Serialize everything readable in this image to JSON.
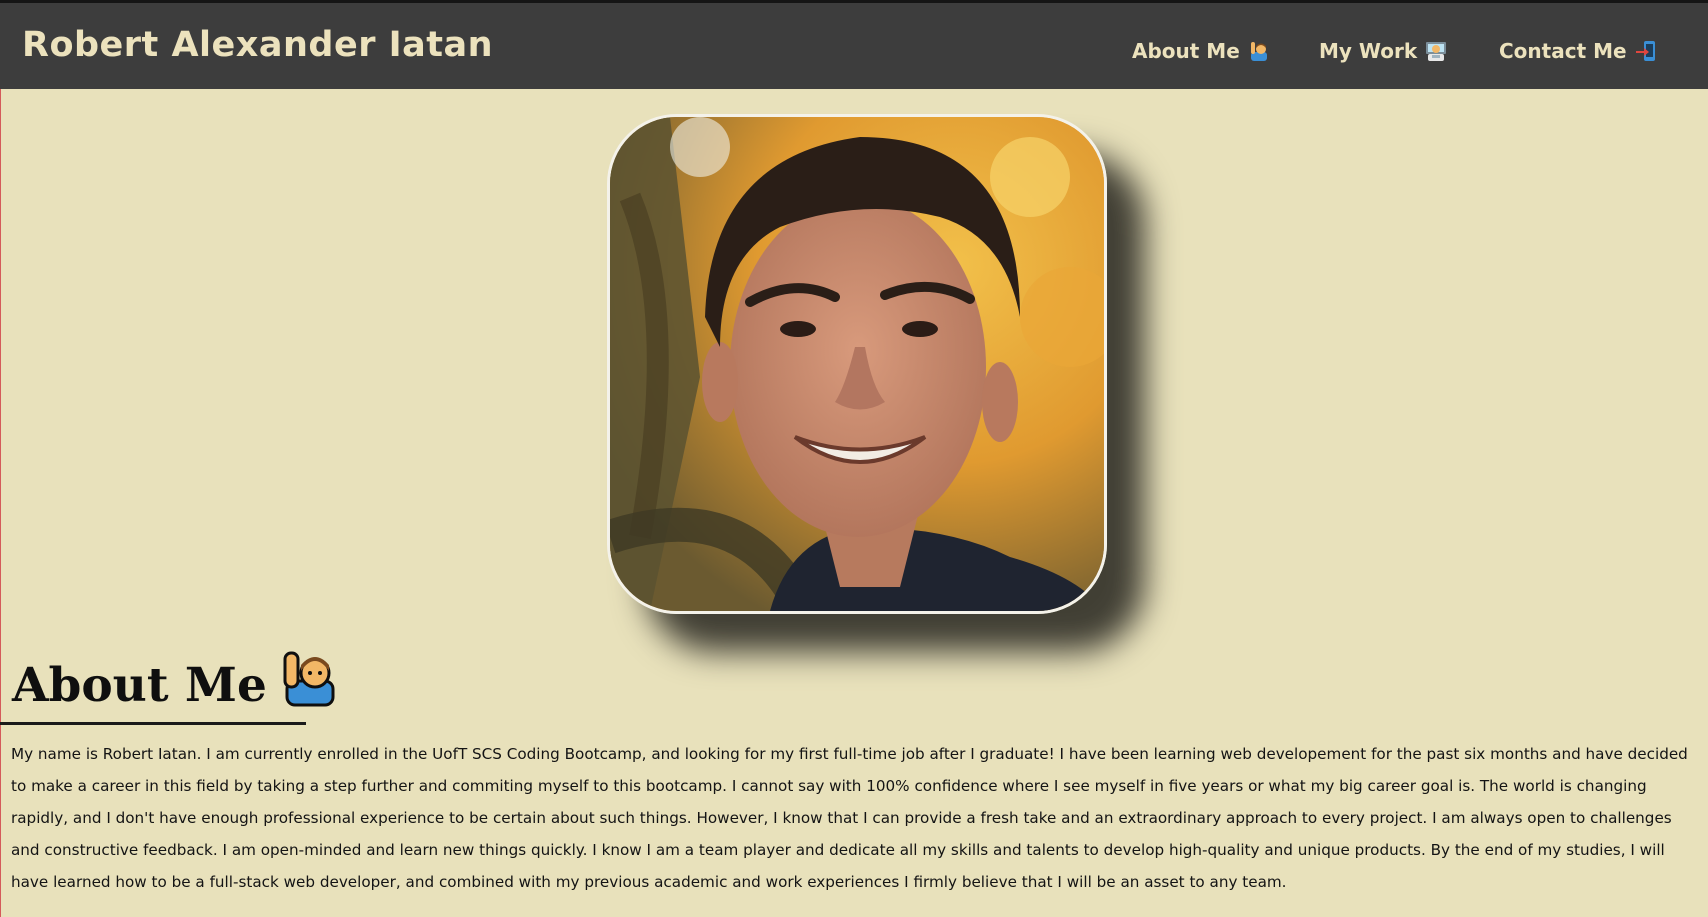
{
  "header": {
    "brand": "Robert Alexander Iatan",
    "nav": [
      {
        "label": "About Me",
        "icon": "person-raising-hand-icon"
      },
      {
        "label": "My Work",
        "icon": "technologist-icon"
      },
      {
        "label": "Contact Me",
        "icon": "mobile-phone-arrow-icon"
      }
    ]
  },
  "about": {
    "heading": "About Me",
    "heading_icon": "person-raising-hand-icon",
    "bio": "My name is Robert Iatan. I am currently enrolled in the UofT SCS Coding Bootcamp, and looking for my first full-time job after I graduate! I have been learning web developement for the past six months and have decided to make a career in this field by taking a step further and commiting myself to this bootcamp. I cannot say with 100% confidence where I see myself in five years or what my big career goal is. The world is changing rapidly, and I don't have enough professional experience to be certain about such things. However, I know that I can provide a fresh take and an extraordinary approach to every project. I am always open to challenges and constructive feedback. I am open-minded and learn new things quickly. I know I am a team player and dedicate all my skills and talents to develop high-quality and unique products. By the end of my studies, I will have learned how to be a full-stack web developer, and combined with my previous academic and work experiences I firmly believe that I will be an asset to any team."
  },
  "colors": {
    "header_bg": "#3d3d3d",
    "header_text": "#ece2bd",
    "page_bg": "#e8e1bb",
    "text": "#141414"
  }
}
